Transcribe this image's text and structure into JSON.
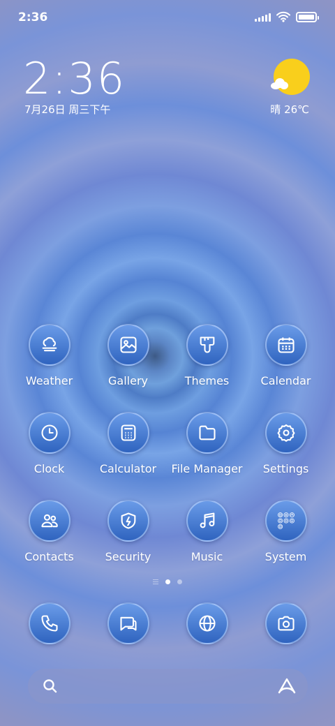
{
  "status_bar": {
    "time": "2:36",
    "icons": [
      "signal-icon",
      "wifi-icon",
      "battery-icon"
    ],
    "battery_level": 1.0
  },
  "widget": {
    "time": "2:36",
    "date": "7月26日 周三下午",
    "weather": "晴 26℃",
    "weather_icon": "sun-cloud-icon"
  },
  "apps": [
    {
      "label": "Weather",
      "icon": "weather-icon"
    },
    {
      "label": "Gallery",
      "icon": "gallery-icon"
    },
    {
      "label": "Themes",
      "icon": "themes-icon"
    },
    {
      "label": "Calendar",
      "icon": "calendar-icon"
    },
    {
      "label": "Clock",
      "icon": "clock-icon"
    },
    {
      "label": "Calculator",
      "icon": "calculator-icon"
    },
    {
      "label": "File Manager",
      "icon": "folder-icon"
    },
    {
      "label": "Settings",
      "icon": "gear-icon"
    },
    {
      "label": "Contacts",
      "icon": "contacts-icon"
    },
    {
      "label": "Security",
      "icon": "shield-icon"
    },
    {
      "label": "Music",
      "icon": "music-icon"
    },
    {
      "label": "System",
      "icon": "folder-grid-icon"
    }
  ],
  "page_indicator": {
    "pages": 2,
    "current": 1
  },
  "dock": [
    {
      "icon": "phone-icon"
    },
    {
      "icon": "messages-icon"
    },
    {
      "icon": "browser-icon"
    },
    {
      "icon": "camera-icon"
    }
  ],
  "search": {
    "icons": [
      "search-icon",
      "assistant-icon"
    ]
  },
  "colors": {
    "icon_top": "#6a9be8",
    "icon_bottom": "#2f64bf",
    "sun": "#f9cf1c"
  }
}
